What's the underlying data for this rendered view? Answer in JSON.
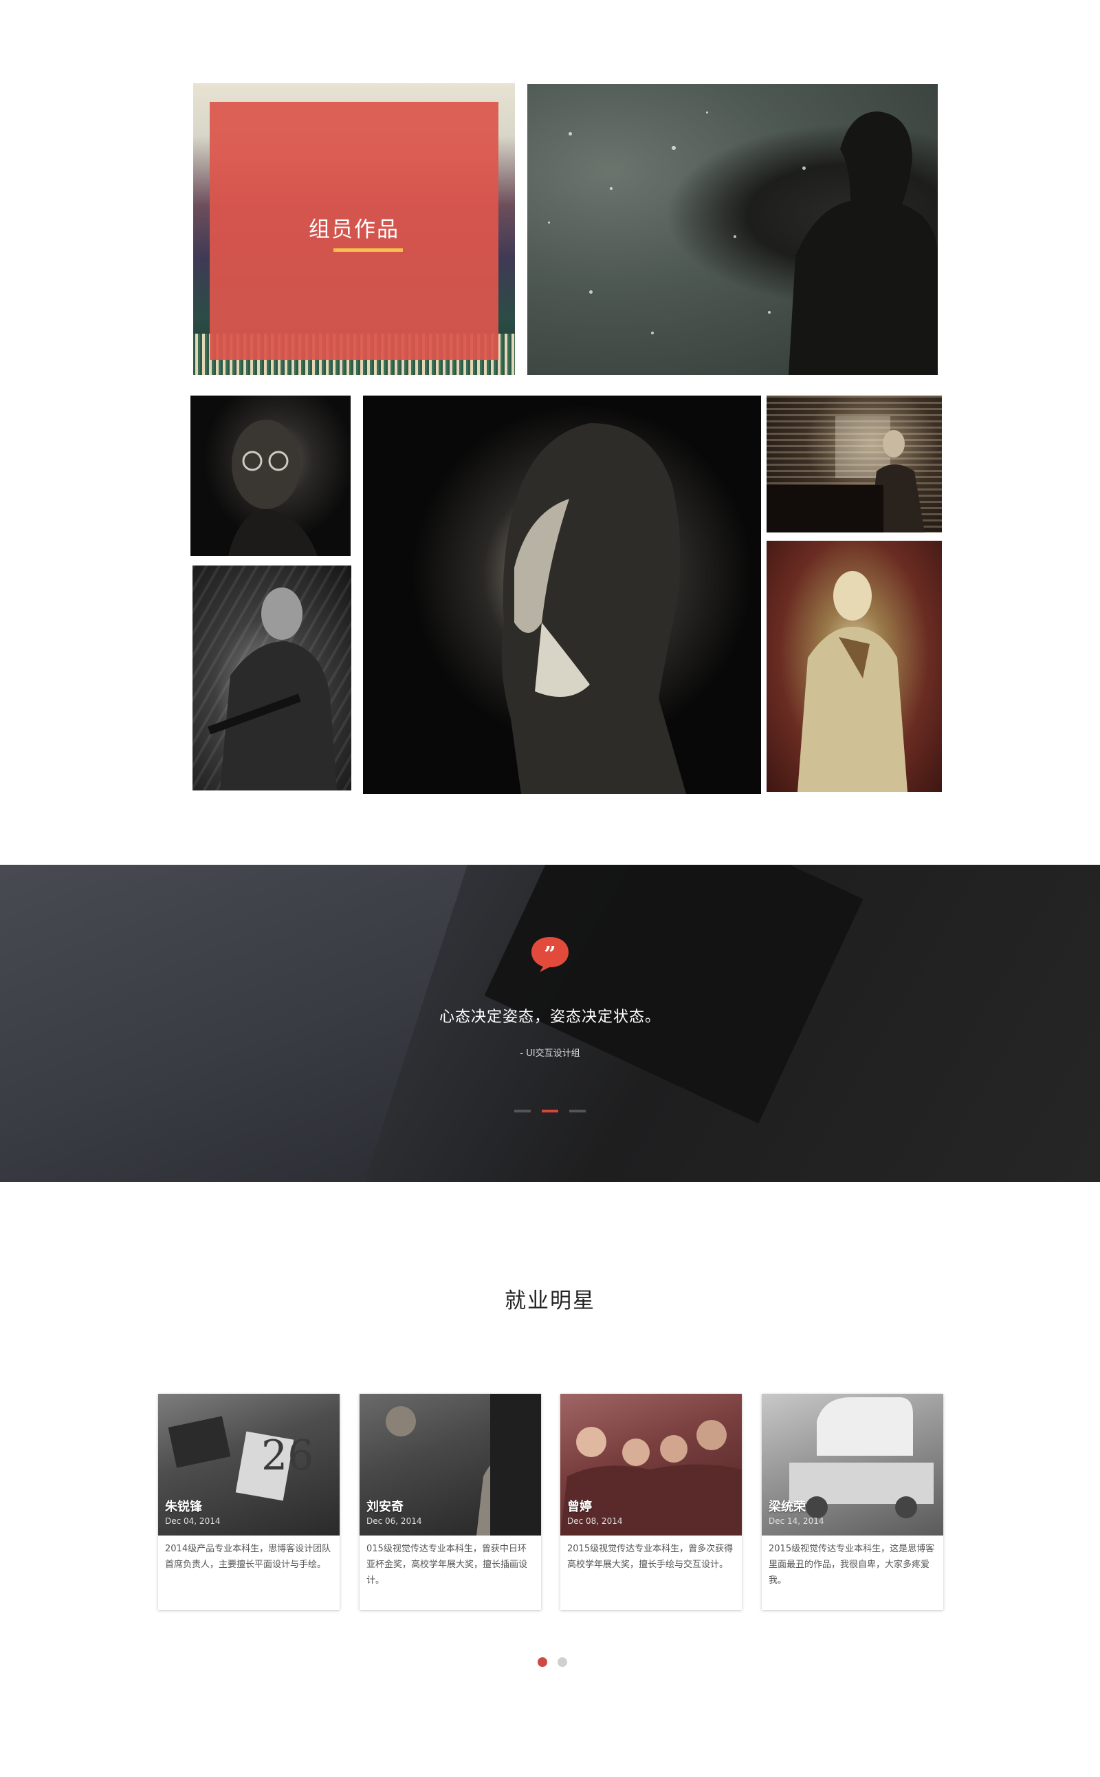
{
  "gallery": {
    "cover_title": "组员作品",
    "accent_color": "#dd564c",
    "underline_color": "#f2c14e",
    "items": [
      {
        "name": "snow-scene-illustration"
      },
      {
        "name": "glasses-portrait"
      },
      {
        "name": "soldier-illustration"
      },
      {
        "name": "bearded-man-portrait"
      },
      {
        "name": "piano-window-illustration"
      },
      {
        "name": "gold-figure-illustration"
      }
    ]
  },
  "quote": {
    "icon": "quote-bubble-icon",
    "icon_color": "#e24b3b",
    "text": "心态决定姿态，姿态决定状态。",
    "author": "- UI交互设计组",
    "slides": [
      {
        "active": false
      },
      {
        "active": true
      },
      {
        "active": false
      }
    ]
  },
  "stars": {
    "title": "就业明星",
    "cards": [
      {
        "name": "朱锐锋",
        "date": "Dec 04, 2014",
        "desc": "2014级产品专业本科生，思博客设计团队首席负责人，主要擅长平面设计与手绘。"
      },
      {
        "name": "刘安奇",
        "date": "Dec 06, 2014",
        "desc": "015级视觉传达专业本科生，曾获中日环亚杯金奖，高校学年展大奖，擅长插画设计。"
      },
      {
        "name": "曾婷",
        "date": "Dec 08, 2014",
        "desc": "2015级视觉传达专业本科生，曾多次获得高校学年展大奖，擅长手绘与交互设计。"
      },
      {
        "name": "梁统荣",
        "date": "Dec 14, 2014",
        "desc": "2015级视觉传达专业本科生，这是思博客里面最丑的作品，我很自卑，大家多疼爱我。"
      }
    ],
    "pager": [
      {
        "active": true
      },
      {
        "active": false
      }
    ]
  }
}
